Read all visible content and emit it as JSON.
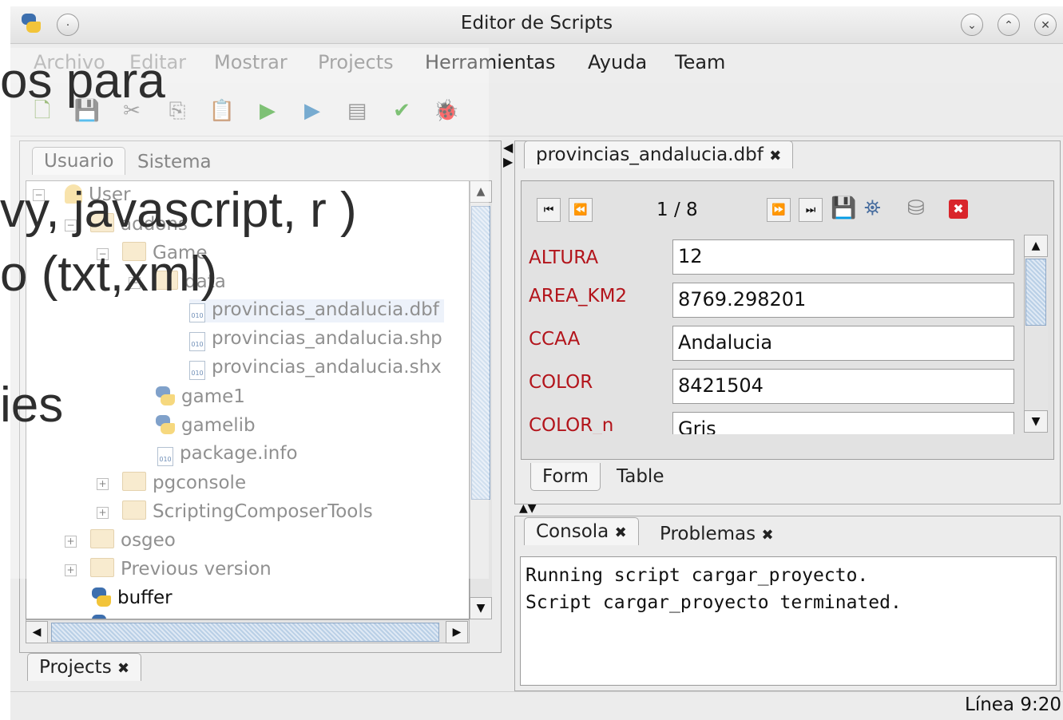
{
  "window": {
    "title": "Editor de Scripts"
  },
  "menu": [
    "Archivo",
    "Editar",
    "Mostrar",
    "Projects",
    "Herramientas",
    "Ayuda",
    "Team"
  ],
  "toolbar_icons": [
    "new-file-icon",
    "save-icon",
    "cut-icon",
    "copy-icon",
    "paste-icon",
    "run-icon",
    "run-config-icon",
    "properties-icon",
    "check-icon",
    "debug-icon"
  ],
  "left_tabs": {
    "usuario": "Usuario",
    "sistema": "Sistema"
  },
  "tree": {
    "user": "User",
    "addons": "addons",
    "game": "Game",
    "data": "data",
    "files": [
      "provincias_andalucia.dbf",
      "provincias_andalucia.shp",
      "provincias_andalucia.shx"
    ],
    "game1": "game1",
    "gamelib": "gamelib",
    "package": "package.info",
    "pgconsole": "pgconsole",
    "sct": "ScriptingComposerTools",
    "osgeo": "osgeo",
    "previous": "Previous version",
    "buffer": "buffer"
  },
  "bottom_tab": {
    "label": "Projects",
    "close": "✖"
  },
  "editor_tab": {
    "label": "provincias_andalucia.dbf",
    "close": "✖"
  },
  "form": {
    "record": "1 / 8",
    "fields": [
      {
        "label": "ALTURA",
        "value": "12"
      },
      {
        "label": "AREA_KM2",
        "value": "8769.298201"
      },
      {
        "label": "CCAA",
        "value": "Andalucia"
      },
      {
        "label": "COLOR",
        "value": "8421504"
      },
      {
        "label": "COLOR_n",
        "value": "Gris"
      }
    ]
  },
  "view_tabs": {
    "form": "Form",
    "table": "Table"
  },
  "console_tabs": {
    "consola": "Consola",
    "problemas": "Problemas",
    "close": "✖"
  },
  "console": {
    "line1": "Running script cargar_proyecto.",
    "line2": "Script cargar_proyecto terminated."
  },
  "status": {
    "line": "Línea 9:20"
  },
  "overlay": {
    "l1": "os para",
    "l2": "vy, javascript, r )",
    "l3": "o (txt,xml)",
    "l4": "ies"
  },
  "colors": {
    "label_red": "#b3141b",
    "accent_blue": "#3d6fae"
  }
}
